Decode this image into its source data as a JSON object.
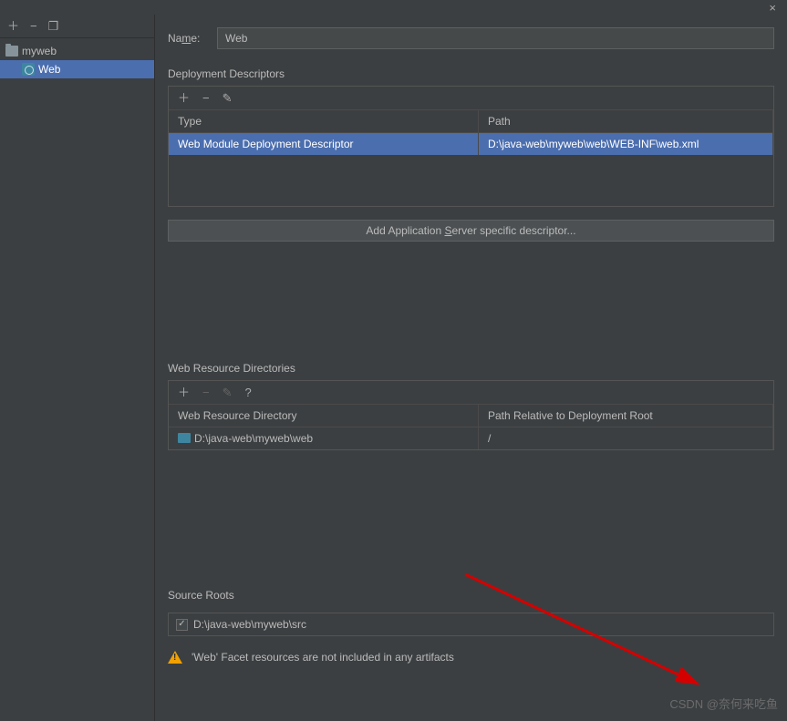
{
  "titlebar": {
    "close": "×"
  },
  "sidebar": {
    "tools": {
      "add": "＋",
      "remove": "−",
      "copy": "❐"
    },
    "tree": {
      "root": "myweb",
      "child": "Web"
    }
  },
  "name": {
    "label_pre": "Na",
    "label_u": "m",
    "label_post": "e:",
    "value": "Web"
  },
  "deploy": {
    "title": "Deployment Descriptors",
    "tools": {
      "add": "＋",
      "remove": "−",
      "edit": "✎"
    },
    "head": {
      "c1": "Type",
      "c2": "Path"
    },
    "row": {
      "c1": "Web Module Deployment Descriptor",
      "c2": "D:\\java-web\\myweb\\web\\WEB-INF\\web.xml"
    },
    "button_pre": "Add Application ",
    "button_u": "S",
    "button_post": "erver specific descriptor..."
  },
  "webres": {
    "title": "Web Resource Directories",
    "tools": {
      "add": "＋",
      "remove": "−",
      "edit": "✎",
      "help": "?"
    },
    "head": {
      "c1": "Web Resource Directory",
      "c2": "Path Relative to Deployment Root"
    },
    "row": {
      "c1": "D:\\java-web\\myweb\\web",
      "c2": "/"
    }
  },
  "source": {
    "title": "Source Roots",
    "row": "D:\\java-web\\myweb\\src",
    "checked": "✓"
  },
  "warning": "'Web' Facet resources are not included in any artifacts",
  "watermark": "CSDN @奈何来吃鱼"
}
